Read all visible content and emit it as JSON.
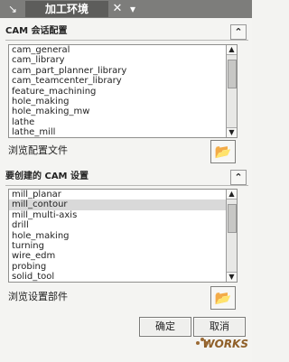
{
  "tab": {
    "title": "加工环境",
    "left_icon": "pin-icon",
    "close_icon": "close-icon",
    "chevron_icon": "chevron-down-icon"
  },
  "config_section": {
    "title": "CAM 会话配置",
    "collapse_icon": "chevron-up-icon",
    "items": [
      "cam_general",
      "cam_library",
      "cam_part_planner_library",
      "cam_teamcenter_library",
      "feature_machining",
      "hole_making",
      "hole_making_mw",
      "lathe",
      "lathe_mill"
    ],
    "browse_label": "浏览配置文件",
    "browse_icon": "folder-open-icon"
  },
  "setup_section": {
    "title": "要创建的 CAM 设置",
    "collapse_icon": "chevron-up-icon",
    "items": [
      "mill_planar",
      "mill_contour",
      "mill_multi-axis",
      "drill",
      "hole_making",
      "turning",
      "wire_edm",
      "probing",
      "solid_tool"
    ],
    "selected_index": 1,
    "browse_label": "浏览设置部件",
    "browse_icon": "folder-open-icon"
  },
  "footer": {
    "ok_label": "确定",
    "cancel_label": "取消"
  },
  "watermark": {
    "text": "WORKS"
  }
}
